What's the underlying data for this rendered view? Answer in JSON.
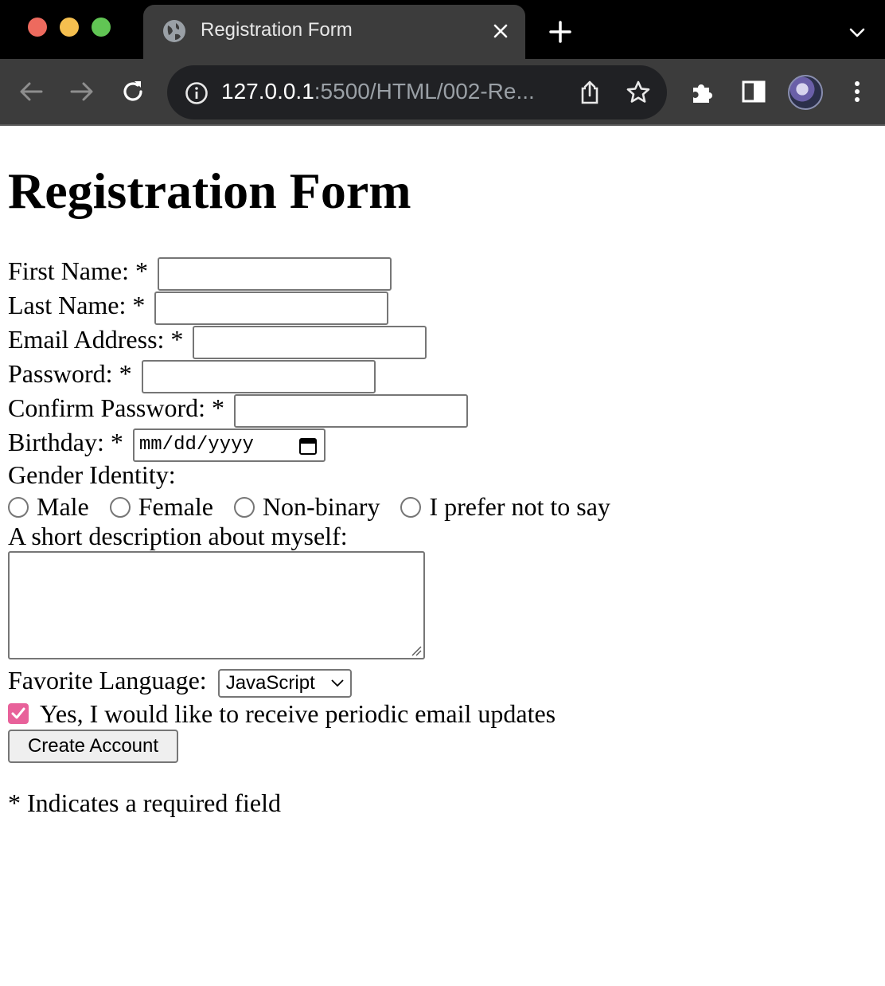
{
  "browser": {
    "tab_title": "Registration Form",
    "url_host": "127.0.0.1",
    "url_rest": ":5500/HTML/002-Re..."
  },
  "page": {
    "heading": "Registration Form",
    "fields": {
      "first_name_label": "First Name: *",
      "last_name_label": "Last Name: *",
      "email_label": "Email Address: *",
      "password_label": "Password: *",
      "confirm_password_label": "Confirm Password: *",
      "birthday_label": "Birthday: *",
      "birthday_placeholder": "mm/dd/yyyy"
    },
    "gender": {
      "label": "Gender Identity:",
      "options": [
        "Male",
        "Female",
        "Non-binary",
        "I prefer not to say"
      ]
    },
    "description_label": "A short description about myself:",
    "language": {
      "label": "Favorite Language:",
      "selected": "JavaScript"
    },
    "newsletter": {
      "label": "Yes, I would like to receive periodic email updates",
      "checked": true
    },
    "submit_label": "Create Account",
    "footnote": "* Indicates a required field"
  },
  "colors": {
    "checkbox_accent": "#e8619a",
    "chrome_dark": "#3c3c3c"
  }
}
